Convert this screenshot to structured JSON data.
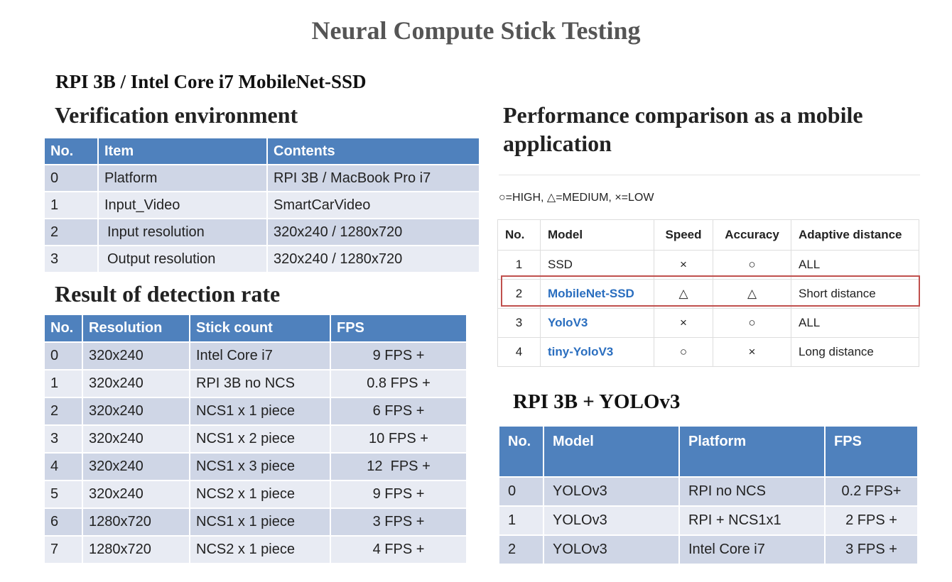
{
  "title": "Neural Compute Stick Testing",
  "subtitle": "RPI 3B / Intel Core i7 MobileNet-SSD",
  "environment": {
    "heading": "Verification environment",
    "headers": [
      "No.",
      "Item",
      "Contents"
    ],
    "rows": [
      [
        "0",
        "Platform",
        "RPI 3B / MacBook Pro i7"
      ],
      [
        "1",
        "Input_Video",
        "SmartCarVideo"
      ],
      [
        "2",
        "Input resolution",
        "320x240 / 1280x720"
      ],
      [
        "3",
        "Output resolution",
        "320x240 / 1280x720"
      ]
    ]
  },
  "detection": {
    "heading": "Result of detection rate",
    "headers": [
      "No.",
      "Resolution",
      "Stick count",
      "FPS"
    ],
    "rows": [
      [
        "0",
        "320x240",
        "Intel Core i7",
        "9 FPS +"
      ],
      [
        "1",
        "320x240",
        "RPI 3B no NCS",
        "0.8 FPS +"
      ],
      [
        "2",
        "320x240",
        "NCS1 x 1 piece",
        "6 FPS +"
      ],
      [
        "3",
        "320x240",
        "NCS1 x 2 piece",
        "10 FPS +"
      ],
      [
        "4",
        "320x240",
        "NCS1 x 3 piece",
        "12  FPS +"
      ],
      [
        "5",
        "320x240",
        "NCS2 x 1 piece",
        "9 FPS +"
      ],
      [
        "6",
        "1280x720",
        "NCS1 x 1 piece",
        "3 FPS +"
      ],
      [
        "7",
        "1280x720",
        "NCS2 x 1 piece",
        "4 FPS +"
      ]
    ]
  },
  "performance": {
    "heading": "Performance comparison as a mobile application",
    "legend": "○=HIGH, △=MEDIUM, ×=LOW",
    "headers": [
      "No.",
      "Model",
      "Speed",
      "Accuracy",
      "Adaptive distance"
    ],
    "rows": [
      [
        "1",
        "SSD",
        "×",
        "○",
        "ALL"
      ],
      [
        "2",
        "MobileNet-SSD",
        "△",
        "△",
        "Short distance"
      ],
      [
        "3",
        "YoloV3",
        "×",
        "○",
        "ALL"
      ],
      [
        "4",
        "tiny-YoloV3",
        "○",
        "×",
        "Long distance"
      ]
    ],
    "link_rows": [
      1,
      2,
      3
    ],
    "highlighted_row": 1,
    "highlight_color": "#c0504d",
    "link_color": "#2a6ebf"
  },
  "yolo": {
    "heading": "RPI 3B + YOLOv3",
    "headers": [
      "No.",
      "Model",
      "Platform",
      "FPS"
    ],
    "rows": [
      [
        "0",
        "YOLOv3",
        "RPI no NCS",
        "0.2 FPS+"
      ],
      [
        "1",
        "YOLOv3",
        "RPI + NCS1x1",
        "2 FPS +"
      ],
      [
        "2",
        "YOLOv3",
        "Intel Core i7",
        "3 FPS +"
      ]
    ]
  },
  "colors": {
    "header_blue": "#4f81bd",
    "row_dark": "#cfd6e6",
    "row_light": "#e8ebf3"
  }
}
